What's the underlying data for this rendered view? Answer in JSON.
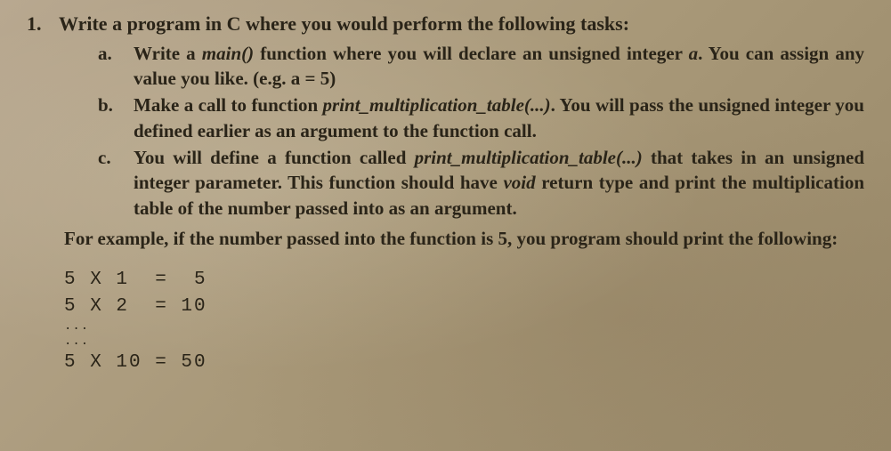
{
  "question": {
    "number": "1.",
    "prompt": "Write a program in C where you would perform the following tasks:",
    "subitems": [
      {
        "letter": "a.",
        "text_parts": [
          {
            "t": "Write a ",
            "i": false
          },
          {
            "t": "main()",
            "i": true
          },
          {
            "t": " function where you will declare an unsigned integer ",
            "i": false
          },
          {
            "t": "a",
            "i": true
          },
          {
            "t": ". You can assign any value you like. (e.g. a = 5)",
            "i": false
          }
        ]
      },
      {
        "letter": "b.",
        "text_parts": [
          {
            "t": "Make a call to function ",
            "i": false
          },
          {
            "t": "print_multiplication_table(...)",
            "i": true
          },
          {
            "t": ". You will pass the unsigned integer you defined earlier as an argument to the function call.",
            "i": false
          }
        ]
      },
      {
        "letter": "c.",
        "text_parts": [
          {
            "t": "You will define a function called ",
            "i": false
          },
          {
            "t": "print_multiplication_table(...)",
            "i": true
          },
          {
            "t": " that takes in an unsigned integer parameter. This function should have ",
            "i": false
          },
          {
            "t": "void",
            "i": true
          },
          {
            "t": " return type and print the multiplication table of the number passed into as an argument.",
            "i": false
          }
        ]
      }
    ],
    "example_intro": "For example, if the number passed into the function is 5, you program should print the following:",
    "example_lines": [
      "5 X 1  =  5",
      "5 X 2  = 10"
    ],
    "ellipsis1": "...",
    "ellipsis2": "...",
    "example_last": "5 X 10 = 50"
  }
}
